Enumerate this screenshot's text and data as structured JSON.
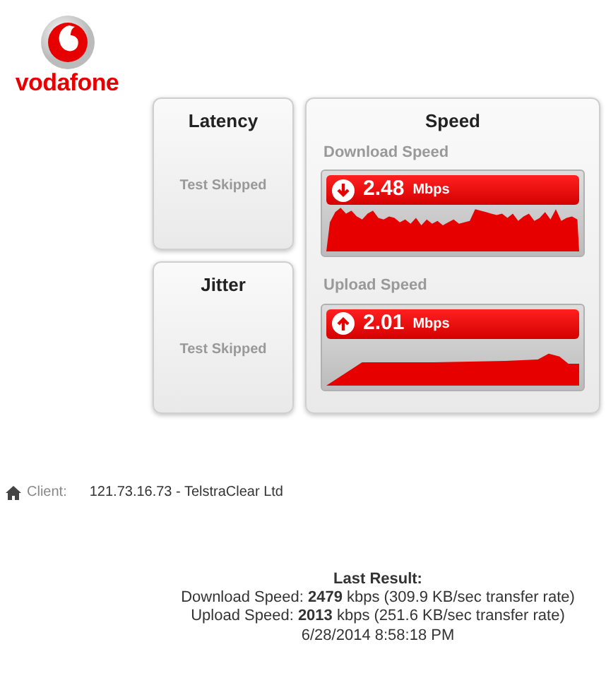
{
  "logo": {
    "text": "vodafone"
  },
  "tests": [
    {
      "title": "Latency",
      "status": "Test Skipped"
    },
    {
      "title": "Jitter",
      "status": "Test Skipped"
    }
  ],
  "speed": {
    "title": "Speed",
    "sections": [
      {
        "label": "Download Speed",
        "kind": "down",
        "value": "2.48",
        "unit": "Mbps"
      },
      {
        "label": "Upload Speed",
        "kind": "up",
        "value": "2.01",
        "unit": "Mbps"
      }
    ]
  },
  "client": {
    "label": "Client:",
    "value": "121.73.16.73 - TelstraClear Ltd"
  },
  "last_result": {
    "title": "Last Result:",
    "lines": [
      "Download Speed: **2479** kbps (309.9 KB/sec transfer rate)",
      "Upload Speed: **2013** kbps (251.6 KB/sec transfer rate)",
      "6/28/2014 8:58:18 PM"
    ]
  }
}
